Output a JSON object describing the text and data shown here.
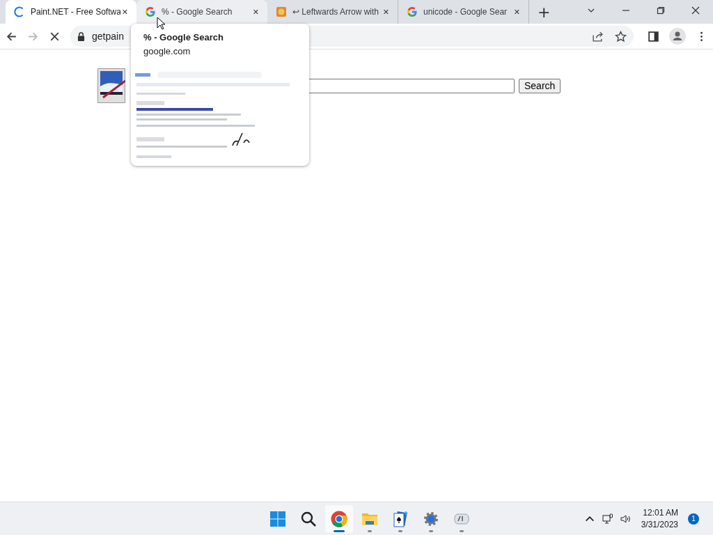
{
  "tabs": [
    {
      "title": "Paint.NET - Free Softwa",
      "kind": "spinner",
      "selected": true,
      "hovered": false,
      "close": "✕"
    },
    {
      "title": "% - Google Search",
      "kind": "google",
      "selected": false,
      "hovered": true,
      "close": "✕"
    },
    {
      "title": "↩ Leftwards Arrow with",
      "kind": "app",
      "selected": false,
      "hovered": false,
      "close": "✕"
    },
    {
      "title": "unicode - Google Sear",
      "kind": "google",
      "selected": false,
      "hovered": false,
      "close": "✕"
    }
  ],
  "new_tab": "+",
  "address_bar": {
    "url": "getpain"
  },
  "hover_card": {
    "title": "% - Google Search",
    "domain": "google.com"
  },
  "page": {
    "search_button": "Search"
  },
  "taskbar": {
    "apps": [
      {
        "kind": "start",
        "active": false,
        "running": false
      },
      {
        "kind": "search",
        "active": false,
        "running": false
      },
      {
        "kind": "chrome",
        "active": true,
        "running": true
      },
      {
        "kind": "files",
        "active": false,
        "running": true
      },
      {
        "kind": "solitaire",
        "active": false,
        "running": true
      },
      {
        "kind": "settings",
        "active": false,
        "running": true
      },
      {
        "kind": "app",
        "active": false,
        "running": true
      }
    ],
    "time": "12:01 AM",
    "date": "3/31/2023",
    "notifications": "1"
  }
}
